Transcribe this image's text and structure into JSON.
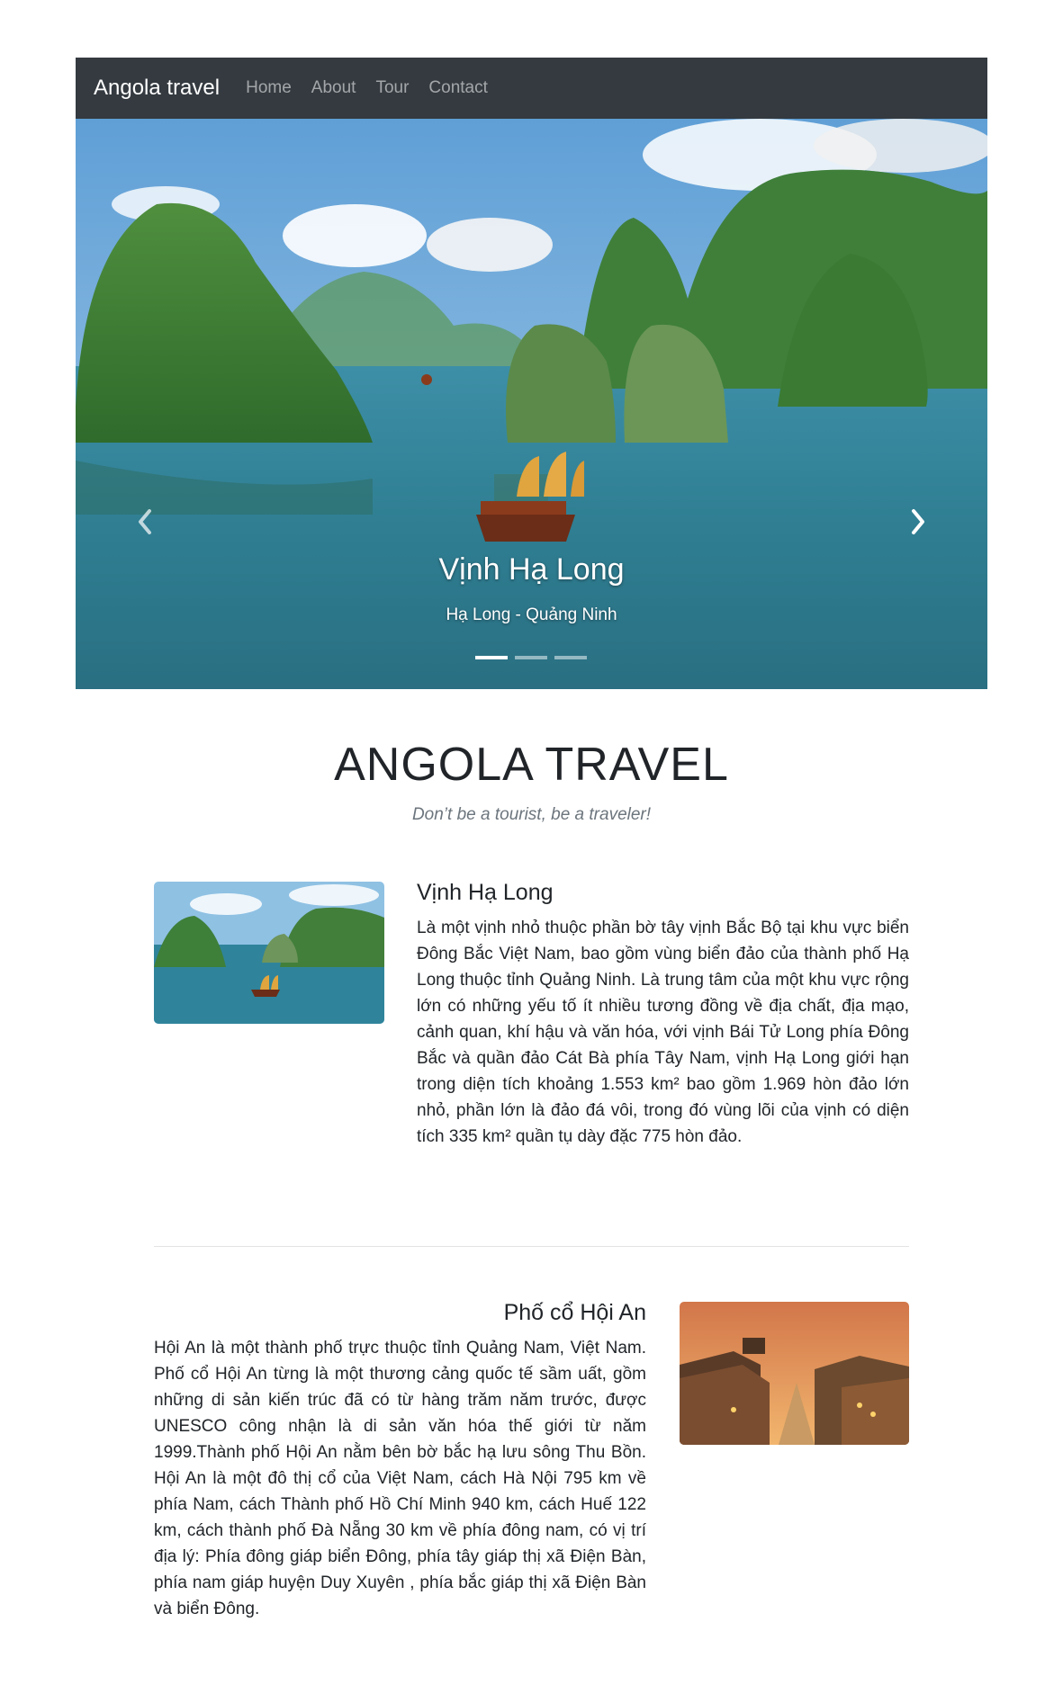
{
  "navbar": {
    "brand": "Angola travel",
    "links": [
      "Home",
      "About",
      "Tour",
      "Contact"
    ]
  },
  "carousel": {
    "caption_title": "Vịnh Hạ Long",
    "caption_subtitle": "Hạ Long - Quảng Ninh",
    "prev_icon": "chevron-left-icon",
    "next_icon": "chevron-right-icon",
    "slide_count": 3,
    "active_slide": 1
  },
  "header": {
    "title": "ANGOLA TRAVEL",
    "tagline": "Don’t be a tourist, be a traveler!"
  },
  "features": [
    {
      "title": "Vịnh Hạ Long",
      "body": "Là một vịnh nhỏ thuộc phần bờ tây vịnh Bắc Bộ tại khu vực biển Đông Bắc Việt Nam, bao gồm vùng biển đảo của thành phố Hạ Long thuộc tỉnh Quảng Ninh. Là trung tâm của một khu vực rộng lớn có những yếu tố ít nhiều tương đồng về địa chất, địa mạo, cảnh quan, khí hậu và văn hóa, với vịnh Bái Tử Long phía Đông Bắc và quần đảo Cát Bà phía Tây Nam, vịnh Hạ Long giới hạn trong diện tích khoảng 1.553 km² bao gồm 1.969 hòn đảo lớn nhỏ, phần lớn là đảo đá vôi, trong đó vùng lõi của vịnh có diện tích 335 km² quần tụ dày đặc 775 hòn đảo."
    },
    {
      "title": "Phố cổ Hội An",
      "body": "Hội An là một thành phố trực thuộc tỉnh Quảng Nam, Việt Nam. Phố cổ Hội An từng là một thương cảng quốc tế sầm uất, gồm những di sản kiến trúc đã có từ hàng trăm năm trước, được UNESCO công nhận là di sản văn hóa thế giới từ năm 1999.Thành phố Hội An nằm bên bờ bắc hạ lưu sông Thu Bồn. Hội An là một đô thị cổ của Việt Nam, cách Hà Nội 795 km về phía Nam, cách Thành phố Hồ Chí Minh 940 km, cách Huế 122 km, cách thành phố Đà Nẵng 30 km về phía đông nam, có vị trí địa lý: Phía đông giáp biển Đông, phía tây giáp thị xã Điện Bàn, phía nam giáp huyện Duy Xuyên , phía bắc giáp thị xã Điện Bàn và biển Đông."
    }
  ]
}
